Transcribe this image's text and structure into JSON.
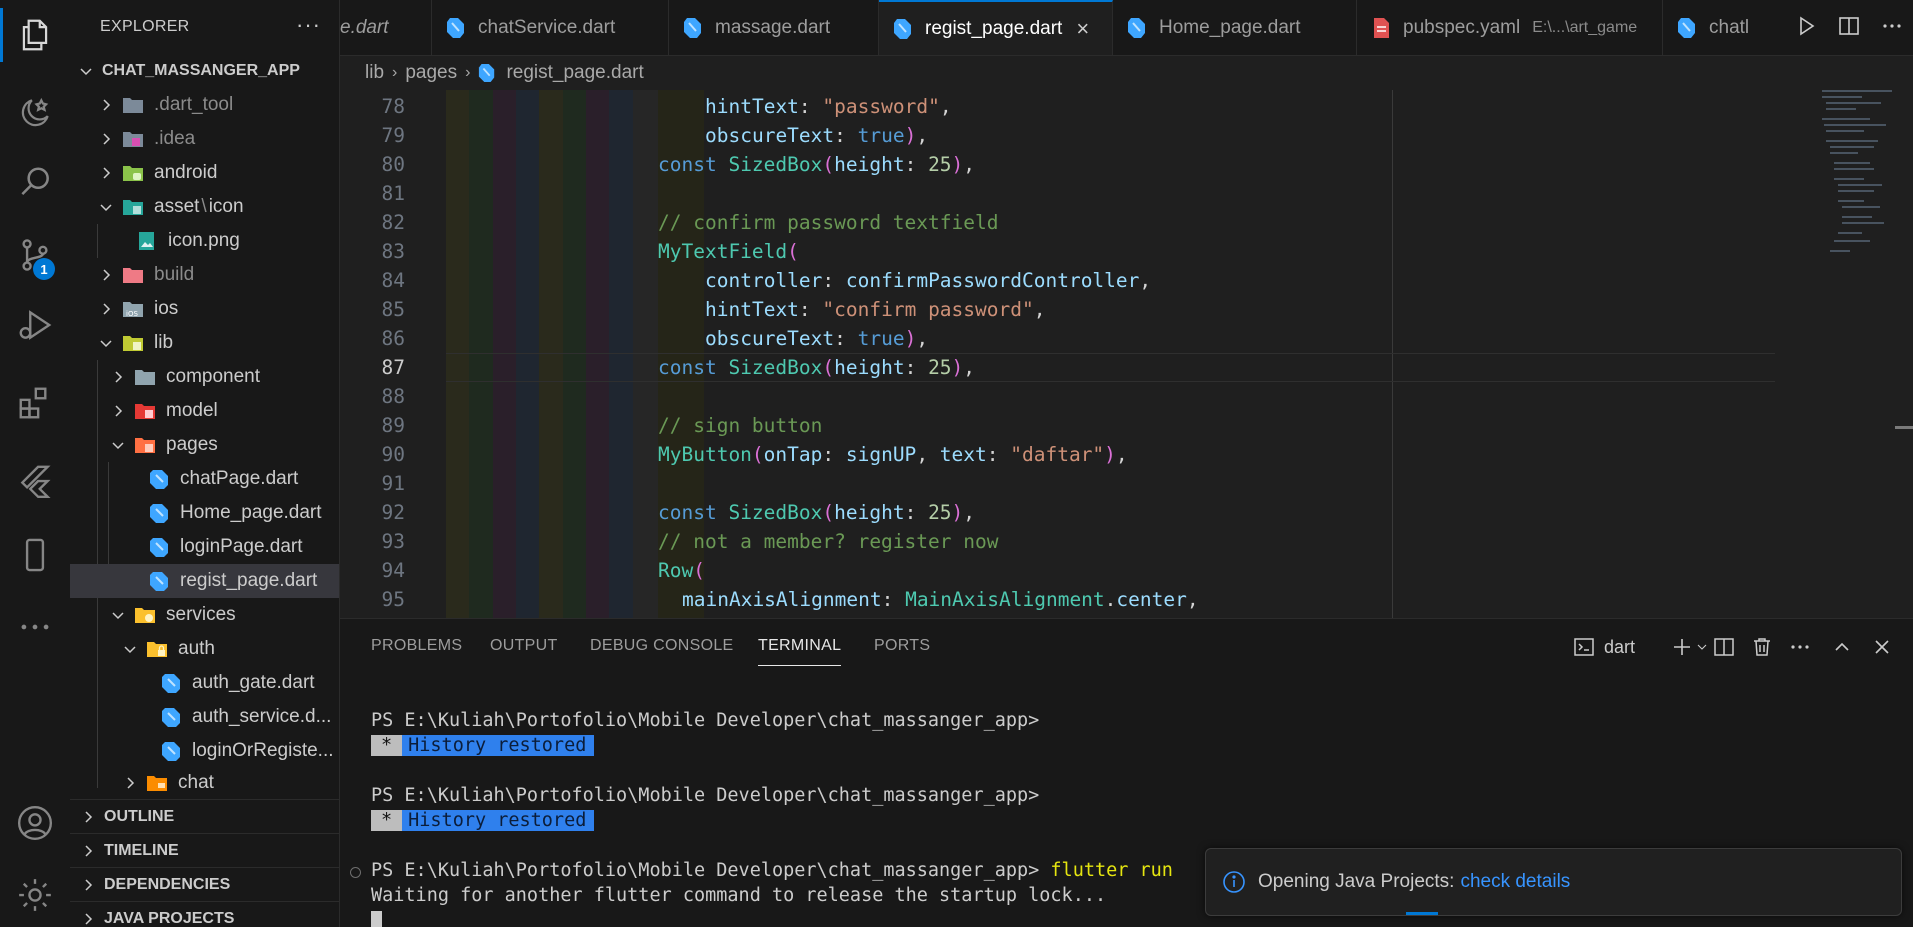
{
  "colors": {
    "accent": "#0078d4",
    "terminal_highlight": "#2f80ed",
    "link": "#3794ff",
    "dart_blue": "#3ea6ff",
    "yaml_red": "#e05252"
  },
  "activity_bar": {
    "items": [
      "explorer-icon",
      "dart-devtools-icon",
      "search-icon",
      "source-control-icon",
      "run-debug-icon",
      "extensions-icon",
      "flutter-icon",
      "device-icon",
      "more-icon",
      "account-icon",
      "settings-icon"
    ],
    "source_control_badge": "1"
  },
  "sidebar": {
    "title": "EXPLORER",
    "more": "···",
    "project": "CHAT_MASSANGER_APP",
    "tree": [
      {
        "label": ".dart_tool",
        "dim": true
      },
      {
        "label": ".idea",
        "dim": true
      },
      {
        "label": "android"
      },
      {
        "label": "asset",
        "label2": "icon"
      },
      {
        "label": "icon.png"
      },
      {
        "label": "build",
        "dim": true
      },
      {
        "label": "ios"
      },
      {
        "label": "lib"
      },
      {
        "label": "component"
      },
      {
        "label": "model"
      },
      {
        "label": "pages"
      },
      {
        "label": "chatPage.dart"
      },
      {
        "label": "Home_page.dart"
      },
      {
        "label": "loginPage.dart"
      },
      {
        "label": "regist_page.dart"
      },
      {
        "label": "services"
      },
      {
        "label": "auth"
      },
      {
        "label": "auth_gate.dart"
      },
      {
        "label": "auth_service.d..."
      },
      {
        "label": "loginOrRegiste..."
      },
      {
        "label": "chat"
      }
    ],
    "sections": [
      "OUTLINE",
      "TIMELINE",
      "DEPENDENCIES",
      "JAVA PROJECTS"
    ]
  },
  "tabs": [
    {
      "label": "e.dart"
    },
    {
      "label": "chatService.dart"
    },
    {
      "label": "massage.dart"
    },
    {
      "label": "regist_page.dart",
      "active": true,
      "close": "×"
    },
    {
      "label": "Home_page.dart"
    },
    {
      "label": "pubspec.yaml",
      "sub": "E:\\...\\art_game"
    },
    {
      "label": "chatl"
    }
  ],
  "breadcrumb": {
    "parts": [
      "lib",
      "pages",
      "regist_page.dart"
    ]
  },
  "editor": {
    "current_line": 87,
    "line_numbers": [
      "78",
      "79",
      "80",
      "81",
      "82",
      "83",
      "84",
      "85",
      "86",
      "87",
      "88",
      "89",
      "90",
      "91",
      "92",
      "93",
      "94",
      "95"
    ]
  },
  "panel": {
    "tabs": [
      "PROBLEMS",
      "OUTPUT",
      "DEBUG CONSOLE",
      "TERMINAL",
      "PORTS"
    ],
    "active_tab": "TERMINAL",
    "terminal_name": "dart",
    "terminal": {
      "prompt": "PS E:\\Kuliah\\Portofolio\\Mobile Developer\\chat_massanger_app>",
      "history_star": "*",
      "history_text": "History restored",
      "command": "flutter run",
      "waiting": "Waiting for another flutter command to release the startup lock..."
    }
  },
  "notification": {
    "text": "Opening Java Projects:",
    "link": "check details"
  }
}
